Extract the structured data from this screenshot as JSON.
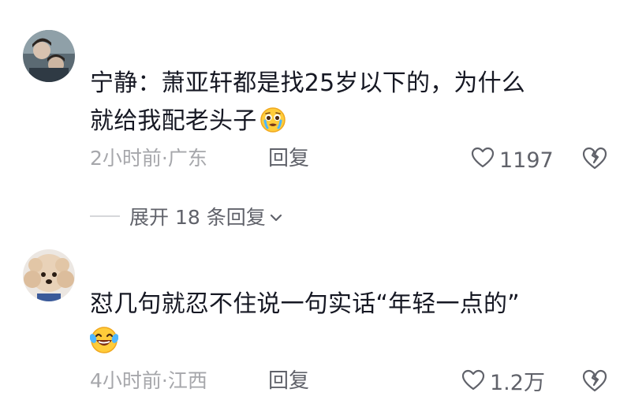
{
  "comments": [
    {
      "text_line1": "宁静：萧亚轩都是找25岁以下的，为什么",
      "text_line2": "就给我配老头子",
      "emoji": "crying-face",
      "meta": "2小时前·广东",
      "reply_label": "回复",
      "likes": "1197"
    },
    {
      "text_line1": "怼几句就忍不住说一句实话“年轻一点的”",
      "emoji": "laughing-tears-face",
      "meta": "4小时前·江西",
      "reply_label": "回复",
      "likes": "1.2万"
    }
  ],
  "expand_replies": {
    "label": "展开 18 条回复"
  },
  "colors": {
    "text": "#161823",
    "meta": "#a6a7ab",
    "action": "#60626a",
    "divider": "#d6d7da"
  }
}
